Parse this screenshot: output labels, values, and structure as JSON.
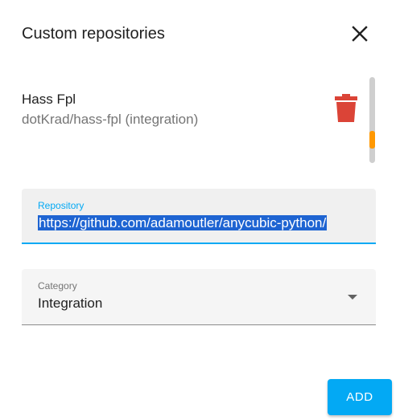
{
  "dialog": {
    "title": "Custom repositories"
  },
  "repositories": [
    {
      "name": "Hass Fpl",
      "subtitle": "dotKrad/hass-fpl (integration)"
    }
  ],
  "repository_field": {
    "label": "Repository",
    "value": "https://github.com/adamoutler/anycubic-python/"
  },
  "category_field": {
    "label": "Category",
    "value": "Integration"
  },
  "actions": {
    "add_label": "ADD"
  },
  "icons": {
    "close": "close-icon",
    "delete": "trash-icon",
    "dropdown": "dropdown-arrow-icon"
  },
  "colors": {
    "accent": "#03a9f4",
    "delete": "#db4437",
    "scroll_thumb": "#ff9800",
    "selection": "#1e64d2"
  }
}
